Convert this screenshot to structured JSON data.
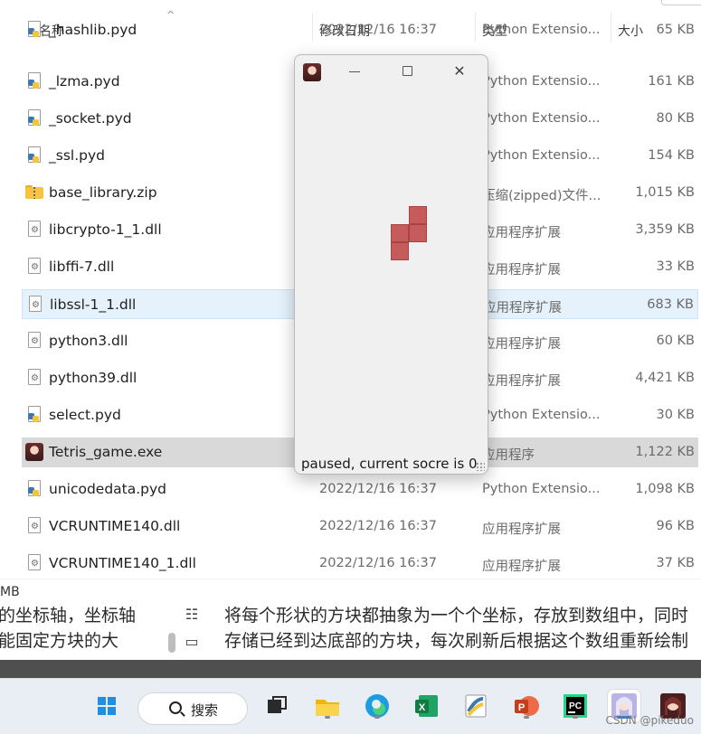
{
  "explorer": {
    "columns": {
      "name": "名称",
      "date": "修改日期",
      "type": "类型",
      "size": "大小"
    },
    "sort_indicator": "^",
    "files": [
      {
        "name": "_hashlib.pyd",
        "date": "2022/12/16 16:37",
        "type": "Python Extensio...",
        "size": "65 KB",
        "icon": "python-file-icon"
      },
      {
        "name": "_lzma.pyd",
        "date": "",
        "type": "Python Extensio...",
        "size": "161 KB",
        "icon": "python-file-icon"
      },
      {
        "name": "_socket.pyd",
        "date": "",
        "type": "Python Extensio...",
        "size": "80 KB",
        "icon": "python-file-icon"
      },
      {
        "name": "_ssl.pyd",
        "date": "",
        "type": "Python Extensio...",
        "size": "154 KB",
        "icon": "python-file-icon"
      },
      {
        "name": "base_library.zip",
        "date": "",
        "type": "压缩(zipped)文件...",
        "size": "1,015 KB",
        "icon": "zip-folder-icon"
      },
      {
        "name": "libcrypto-1_1.dll",
        "date": "",
        "type": "应用程序扩展",
        "size": "3,359 KB",
        "icon": "dll-file-icon"
      },
      {
        "name": "libffi-7.dll",
        "date": "",
        "type": "应用程序扩展",
        "size": "33 KB",
        "icon": "dll-file-icon"
      },
      {
        "name": "libssl-1_1.dll",
        "date": "",
        "type": "应用程序扩展",
        "size": "683 KB",
        "icon": "dll-file-icon"
      },
      {
        "name": "python3.dll",
        "date": "",
        "type": "应用程序扩展",
        "size": "60 KB",
        "icon": "dll-file-icon"
      },
      {
        "name": "python39.dll",
        "date": "",
        "type": "应用程序扩展",
        "size": "4,421 KB",
        "icon": "dll-file-icon"
      },
      {
        "name": "select.pyd",
        "date": "",
        "type": "Python Extensio...",
        "size": "30 KB",
        "icon": "python-file-icon"
      },
      {
        "name": "Tetris_game.exe",
        "date": "",
        "type": "应用程序",
        "size": "1,122 KB",
        "icon": "tetris-app-icon"
      },
      {
        "name": "unicodedata.pyd",
        "date": "2022/12/16 16:37",
        "type": "Python Extensio...",
        "size": "1,098 KB",
        "icon": "python-file-icon"
      },
      {
        "name": "VCRUNTIME140.dll",
        "date": "2022/12/16 16:37",
        "type": "应用程序扩展",
        "size": "96 KB",
        "icon": "dll-file-icon"
      },
      {
        "name": "VCRUNTIME140_1.dll",
        "date": "2022/12/16 16:37",
        "type": "应用程序扩展",
        "size": "37 KB",
        "icon": "dll-file-icon"
      }
    ],
    "hovered_index": 7,
    "selected_index": 11,
    "status_fragment": "MB"
  },
  "tetris_window": {
    "status": "paused, current socre is 0",
    "block_color": "#c65b5b"
  },
  "article": {
    "left_line1": "的坐标轴，坐标轴",
    "left_line2": "能固定方块的大",
    "right_line1": "将每个形状的方块都抽象为一个个坐标，存放到数组中，同时",
    "right_line2": "存储已经到达底部的方块，每次刷新后根据这个数组重新绘制"
  },
  "taskbar": {
    "search_label": "搜索",
    "watermark": "CSDN @pikeduo",
    "apps": [
      "windows-start-icon",
      "task-view-icon",
      "file-explorer-icon",
      "edge-browser-icon",
      "excel-icon",
      "python-idle-icon",
      "powerpoint-icon",
      "pycharm-icon",
      "anime-avatar-app-icon",
      "tetris-app-icon"
    ]
  }
}
